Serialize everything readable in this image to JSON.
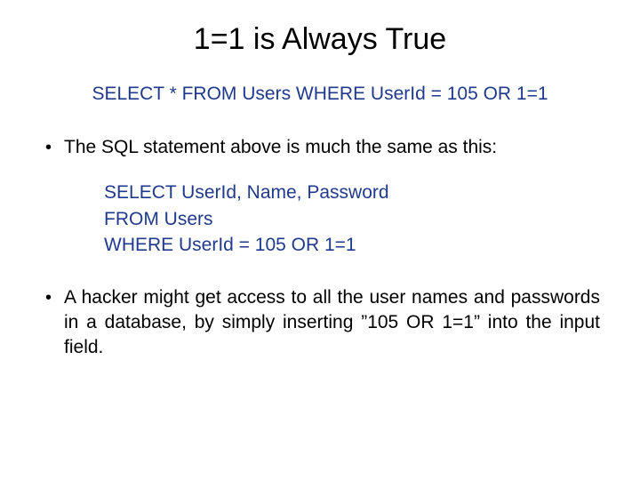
{
  "title": "1=1 is Always True",
  "sqlMain": "SELECT * FROM Users WHERE UserId = 105 OR 1=1",
  "bullet1": "The SQL statement above is much the same as this:",
  "sqlInner": {
    "line1": "SELECT UserId, Name, Password",
    "line2": "FROM Users",
    "line3": "WHERE UserId = 105 OR 1=1"
  },
  "bullet2": "A hacker might get access to all the user names and passwords in a database, by simply inserting ”105 OR 1=1” into the input field."
}
